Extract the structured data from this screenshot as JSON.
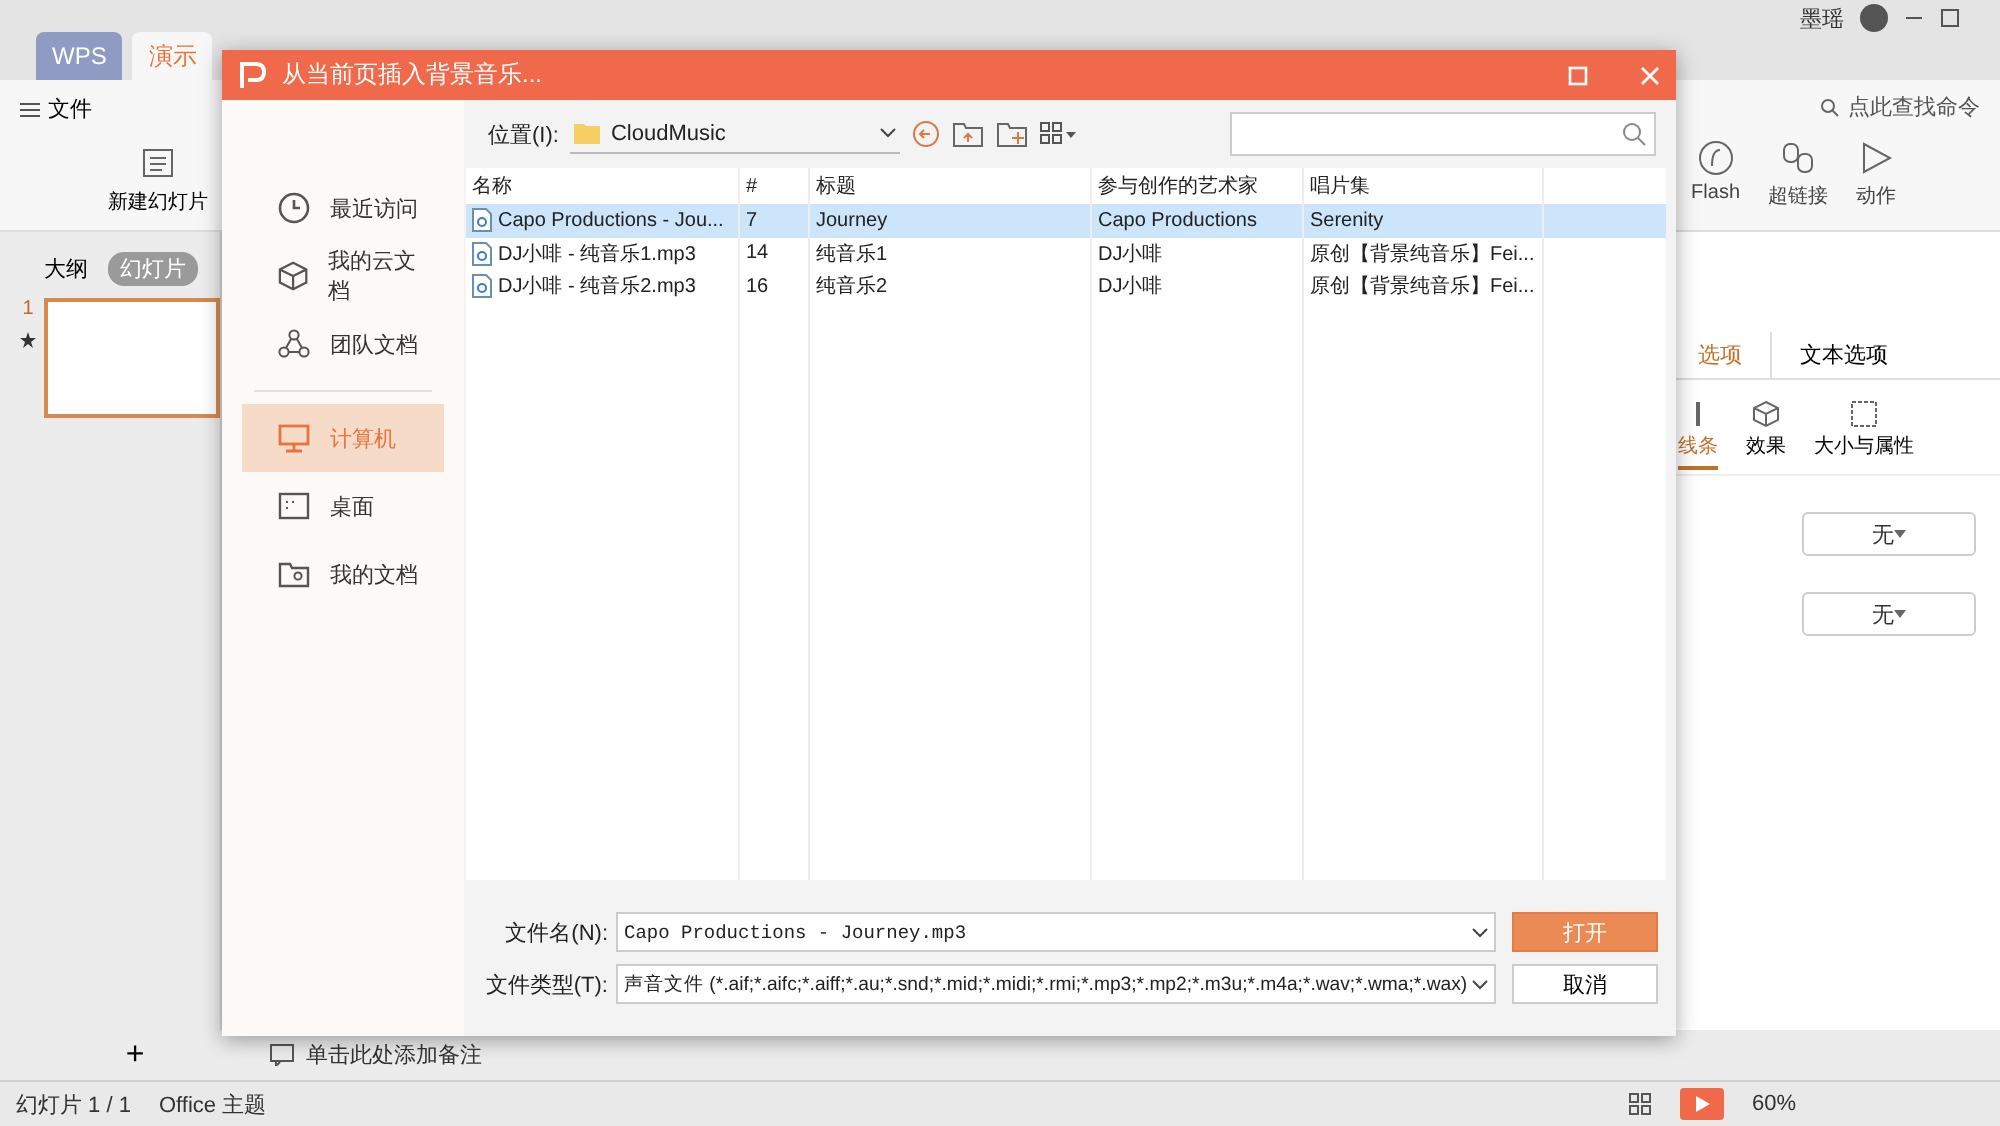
{
  "app": {
    "tabs": [
      {
        "label": "WPS",
        "selected": false
      },
      {
        "label": "演示",
        "selected": true
      }
    ],
    "user": "墨瑶",
    "menu_label": "文件",
    "new_slide": "新建幻灯片",
    "command_search": "点此查找命令",
    "ribbon": [
      {
        "label": "Flash"
      },
      {
        "label": "超链接"
      },
      {
        "label": "动作"
      }
    ],
    "outline_tabs": [
      {
        "label": "大纲",
        "selected": false
      },
      {
        "label": "幻灯片",
        "selected": true
      }
    ],
    "slide_number": "1",
    "add": "+",
    "notes_placeholder": "单击此处添加备注",
    "panel": {
      "tabs": [
        {
          "label": "选项",
          "selected": true
        },
        {
          "label": "文本选项",
          "selected": false
        }
      ],
      "subtabs": [
        {
          "label": "线条",
          "selected": true
        },
        {
          "label": "效果",
          "selected": false
        },
        {
          "label": "大小与属性",
          "selected": false
        }
      ],
      "dropdowns": [
        "无",
        "无"
      ]
    },
    "status": {
      "slide": "幻灯片 1 / 1",
      "theme": "Office 主题",
      "zoom": "60%"
    }
  },
  "dialog": {
    "title": "从当前页插入背景音乐...",
    "places": [
      {
        "label": "最近访问",
        "selected": false
      },
      {
        "label": "我的云文档",
        "selected": false
      },
      {
        "label": "团队文档",
        "selected": false
      },
      {
        "label": "计算机",
        "selected": true
      },
      {
        "label": "桌面",
        "selected": false
      },
      {
        "label": "我的文档",
        "selected": false
      }
    ],
    "location_label": "位置(I):",
    "location": "CloudMusic",
    "columns": [
      "名称",
      "#",
      "标题",
      "参与创作的艺术家",
      "唱片集"
    ],
    "rows": [
      {
        "cells": [
          "Capo Productions - Jou...",
          "7",
          "Journey",
          "Capo Productions",
          "Serenity"
        ],
        "selected": true
      },
      {
        "cells": [
          "DJ小啡 - 纯音乐1.mp3",
          "14",
          "纯音乐1",
          "DJ小啡",
          "原创【背景纯音乐】Fei..."
        ],
        "selected": false
      },
      {
        "cells": [
          "DJ小啡 - 纯音乐2.mp3",
          "16",
          "纯音乐2",
          "DJ小啡",
          "原创【背景纯音乐】Fei..."
        ],
        "selected": false
      }
    ],
    "filename_label": "文件名(N):",
    "filename": "Capo Productions - Journey.mp3",
    "filetype_label": "文件类型(T):",
    "filetype": "声音文件 (*.aif;*.aifc;*.aiff;*.au;*.snd;*.mid;*.midi;*.rmi;*.mp3;*.mp2;*.m3u;*.m4a;*.wav;*.wma;*.wax)",
    "open_button": "打开",
    "cancel_button": "取消"
  }
}
